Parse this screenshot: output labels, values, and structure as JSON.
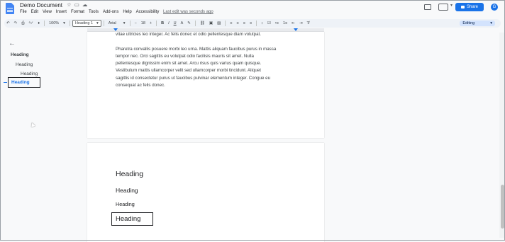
{
  "app": {
    "title": "Demo Document",
    "menu": [
      "File",
      "Edit",
      "View",
      "Insert",
      "Format",
      "Tools",
      "Add-ons",
      "Help",
      "Accessibility"
    ],
    "last_edit": "Last edit was seconds ago",
    "share_label": "Share"
  },
  "toolbar": {
    "zoom": "100%",
    "style": "Heading 1",
    "font": "Arial",
    "size": "18",
    "mode": "Editing"
  },
  "outline": {
    "items": [
      {
        "label": "Heading",
        "level": 1
      },
      {
        "label": "Heading",
        "level": 2
      },
      {
        "label": "Heading",
        "level": 3
      },
      {
        "label": "Heading",
        "level": 1,
        "active": true
      }
    ]
  },
  "doc": {
    "cut_text": "vitae ultricies leo integer. Ac felis donec et odio pellentesque diam volutpat.",
    "para_lines": [
      "vitae ultricies leo integer. Ac felis donec et odio pellentesque diam volutpat.",
      "",
      "Pharetra convallis posuere morbi leo urna. Mattis aliquam faucibus purus in massa",
      "tempor nec. Orci sagittis eu volutpat odio facilisis mauris sit amet. Nulla",
      "pellentesque dignissim enim sit amet. Arcu risus quis varius quam quisque.",
      "Vestibulum mattis ullamcorper velit sed ullamcorper morbi tincidunt. Aliquet",
      "sagittis id consectetur purus ut faucibus pulvinar elementum integer. Congue eu",
      "consequat ac felis donec."
    ],
    "headings": [
      "Heading",
      "Heading",
      "Heading",
      "Heading"
    ]
  }
}
